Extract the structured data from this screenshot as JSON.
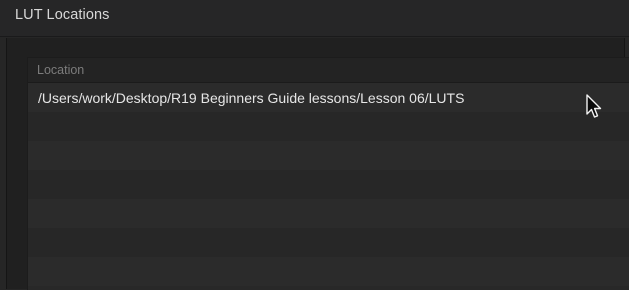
{
  "dialog": {
    "title": "LUT Locations"
  },
  "table": {
    "column_header": "Location",
    "rows": [
      "/Users/work/Desktop/R19 Beginners Guide lessons/Lesson 06/LUTS",
      "",
      "",
      "",
      "",
      "",
      ""
    ]
  },
  "pointer": {
    "icon": "mouse-pointer-icon"
  }
}
